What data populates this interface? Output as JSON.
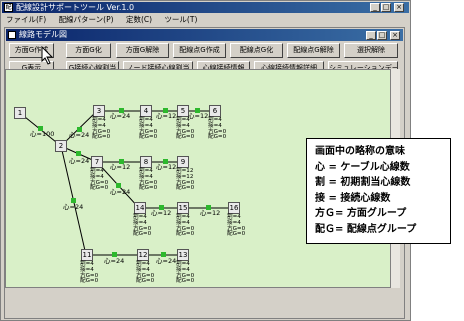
{
  "main_window": {
    "title": "配線設計サポートツール Ver.1.0",
    "icon_text": "配"
  },
  "menu": [
    "ファイル(F)",
    "配線パターン(P)",
    "定数(C)",
    "ツール(T)"
  ],
  "child_window": {
    "title": "線路モデル図"
  },
  "toolbar_row1": [
    "方面G作成",
    "方面G化",
    "方面G解除",
    "配線点G作成",
    "配線点G化",
    "配線点G解除",
    "選択解除"
  ],
  "toolbar_row2": [
    "G表示",
    "G接続心線割当",
    "ノード接続心線割当",
    "心線接続情報",
    "心線接続情報詳細",
    "シミュレーションデータ作成"
  ],
  "diagram": {
    "nodes": [
      "1",
      "2",
      "3",
      "4",
      "5",
      "6",
      "7",
      "8",
      "9",
      "14",
      "15",
      "16",
      "11",
      "12",
      "13"
    ],
    "edge_labels": [
      "心=100",
      "心=24",
      "心=24",
      "心=12",
      "心=12",
      "心=24",
      "心=12",
      "心=12",
      "心=24",
      "心=24",
      "心=12",
      "心=12",
      "心=24",
      "心=24",
      "心=12",
      "心=12"
    ],
    "node_info": {
      "n3": "割=4\n接=4\n方G=0\n配G=0",
      "n4": "割=4\n接=4\n方G=0\n配G=0",
      "n5": "割=4\n接=4\n方G=0\n配G=0",
      "n6": "割=4\n接=4\n方G=0\n配G=0",
      "n7": "割=4\n接=4\n方G=0\n配G=0",
      "n8": "割=4\n接=4\n方G=0\n配G=0",
      "n9": "割=12\n接=12\n方G=0\n配G=0",
      "n14": "割=4\n接=4\n方G=0\n配G=0",
      "n15": "割=4\n接=4\n方G=0\n配G=0",
      "n16": "割=4\n接=4\n方G=0\n配G=0",
      "n11": "割=4\n接=4\n方G=0\n配G=0",
      "n12": "割=4\n接=4\n方G=0\n配G=0",
      "n13": "割=4\n接=4\n方G=0\n配G=0"
    }
  },
  "legend": {
    "title": "画面中の略称の意味",
    "lines": [
      "心 = ケーブル心線数",
      "割 = 初期割当心線数",
      "接 = 接続心線数",
      "方Ｇ= 方面グループ",
      "配Ｇ= 配線点グループ"
    ]
  },
  "colors": {
    "title_bar": "#0a246a",
    "canvas_bg": "#d9f0c8",
    "window_bg": "#d4d0c8",
    "edge_marker": "#2db82d"
  }
}
